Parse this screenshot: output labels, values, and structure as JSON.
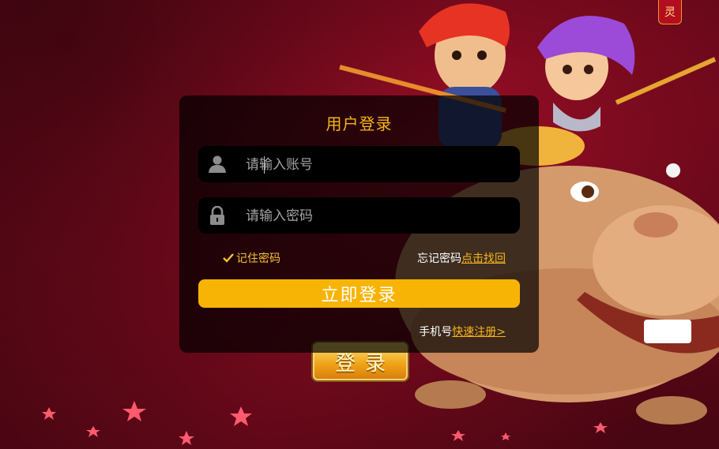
{
  "corner_badge": "灵",
  "login": {
    "title": "用户登录",
    "account_placeholder": "请输入账号",
    "password_placeholder": "请输入密码",
    "remember_label": "记住密码",
    "remember_checked": true,
    "forgot_text": "忘记密码",
    "forgot_link": "点击找回",
    "submit_label": "立即登录",
    "phone_text": "手机号",
    "register_link": "快速注册>"
  },
  "game_button_label": "登录",
  "icons": {
    "account": "user-icon",
    "password": "lock-icon",
    "remember": "checkmark-icon"
  },
  "colors": {
    "accent": "#f8b405",
    "title": "#f7b51a",
    "background": "#7a0a1e"
  }
}
